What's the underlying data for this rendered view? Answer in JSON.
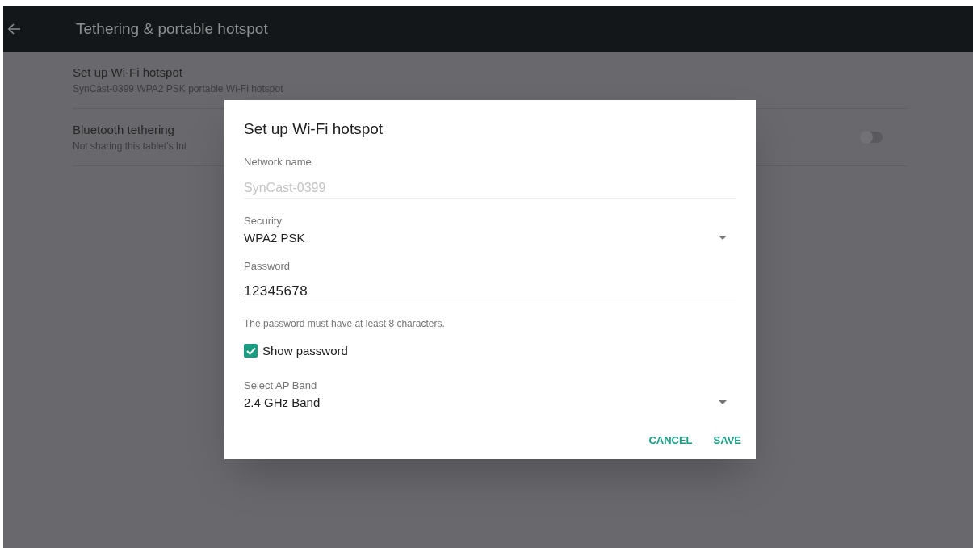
{
  "app_bar": {
    "title": "Tethering & portable hotspot"
  },
  "settings": [
    {
      "kind": "plain",
      "title": "Set up Wi-Fi hotspot",
      "summary": "SynCast-0399 WPA2 PSK portable Wi-Fi hotspot"
    },
    {
      "kind": "toggle",
      "title": "Bluetooth tethering",
      "summary": "Not sharing this tablet’s Int",
      "on": false
    }
  ],
  "dialog": {
    "title": "Set up Wi-Fi hotspot",
    "network_name": {
      "label": "Network name",
      "placeholder": "SynCast-0399"
    },
    "security": {
      "label": "Security",
      "value": "WPA2 PSK"
    },
    "password": {
      "label": "Password",
      "value": "12345678",
      "hint": "The password must have at least 8 characters."
    },
    "show_password": {
      "label": "Show password",
      "checked": true
    },
    "ap_band": {
      "label": "Select AP Band",
      "value": "2.4 GHz Band"
    },
    "buttons": [
      "CANCEL",
      "SAVE"
    ]
  }
}
